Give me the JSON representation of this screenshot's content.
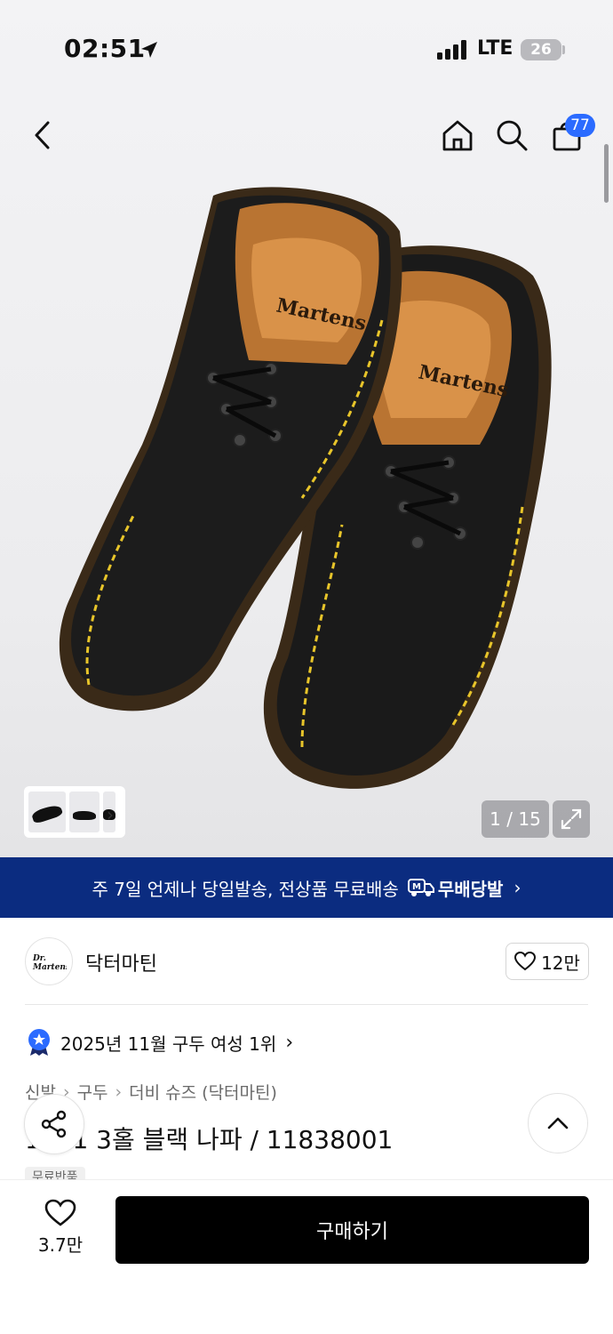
{
  "status_bar": {
    "time": "02:51",
    "network": "LTE",
    "battery": "26"
  },
  "nav": {
    "cart_count": "77"
  },
  "gallery": {
    "pager": "1 / 15"
  },
  "banner": {
    "text": "주 7일 언제나 당일발송, 전상품 무료배송",
    "badge": "무배당발"
  },
  "brand": {
    "name": "닥터마틴",
    "logo_text": "Dr.Martens",
    "likes": "12만"
  },
  "ranking": {
    "text": "2025년 11월 구두 여성 1위"
  },
  "breadcrumb": [
    "신발",
    "구두",
    "더비 슈즈 (닥터마틴)"
  ],
  "product": {
    "title": "1461 3홀 블랙 나파 / 11838001",
    "chip": "무료반품"
  },
  "bottom": {
    "wish_count": "3.7만",
    "buy_label": "구매하기"
  },
  "colors": {
    "banner_bg": "#0b2c80",
    "accent": "#2b6bff",
    "buy_bg": "#000000"
  }
}
